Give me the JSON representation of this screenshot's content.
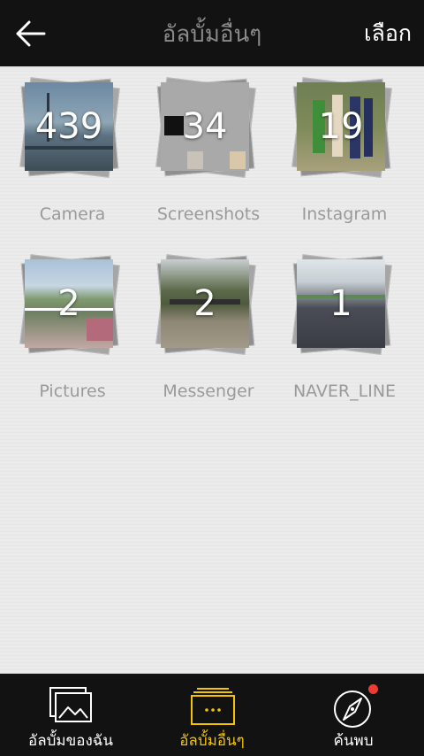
{
  "header": {
    "title": "อัลบั้มอื่นๆ",
    "select_label": "เลือก"
  },
  "albums": [
    {
      "name": "Camera",
      "count": "439"
    },
    {
      "name": "Screenshots",
      "count": "34"
    },
    {
      "name": "Instagram",
      "count": "19"
    },
    {
      "name": "Pictures",
      "count": "2"
    },
    {
      "name": "Messenger",
      "count": "2"
    },
    {
      "name": "NAVER_LINE",
      "count": "1"
    }
  ],
  "tabs": [
    {
      "label": "อัลบั้มของฉัน",
      "icon": "photo-album-icon"
    },
    {
      "label": "อัลบั้มอื่นๆ",
      "icon": "more-albums-icon"
    },
    {
      "label": "ค้นพบ",
      "icon": "compass-icon"
    }
  ],
  "colors": {
    "accent": "#f5c400",
    "badge": "#ef3a32",
    "bar": "#121212"
  }
}
